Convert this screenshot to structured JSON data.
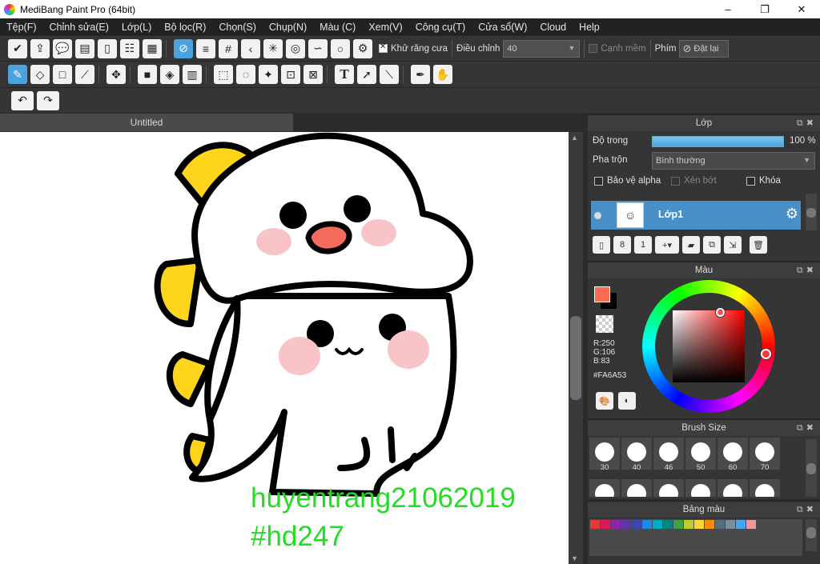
{
  "window": {
    "title": "MediBang Paint Pro (64bit)",
    "minimize": "–",
    "maximize": "❐",
    "close": "✕"
  },
  "menu": [
    "Tệp(F)",
    "Chỉnh sửa(E)",
    "Lớp(L)",
    "Bộ lọc(R)",
    "Chọn(S)",
    "Chụp(N)",
    "Màu (C)",
    "Xem(V)",
    "Công cụ(T)",
    "Cửa sổ(W)",
    "Cloud",
    "Help"
  ],
  "toolbar1": {
    "antialias_label": "Khử răng cưa",
    "adjust_label": "Điều chỉnh",
    "adjust_value": "40",
    "soft_edge_label": "Cạnh mềm",
    "key_label": "Phím",
    "reset_label": "Đặt lại"
  },
  "tab": {
    "title": "Untitled"
  },
  "canvas": {
    "watermark_line1": "huyentrang21062019",
    "watermark_line2": "#hd247",
    "watermark_color": "#22dd22"
  },
  "layer_panel": {
    "title": "Lớp",
    "opacity_label": "Độ trong",
    "opacity_value": "100 %",
    "opacity_fraction": 1.0,
    "blend_label": "Pha trộn",
    "blend_value": "Bình thường",
    "protect_alpha": "Bảo vệ alpha",
    "clipping": "Xén bớt",
    "lock": "Khóa",
    "layer_name": "Lớp1"
  },
  "color_panel": {
    "title": "Màu",
    "r": "R:250",
    "g": "G:106",
    "b": "B:83",
    "hex": "#FA6A53",
    "fg_color": "#FA6A53",
    "bg_color": "#000000"
  },
  "brush_panel": {
    "title": "Brush Size",
    "sizes": [
      "30",
      "40",
      "46",
      "50",
      "60",
      "70"
    ]
  },
  "palette_panel": {
    "title": "Bảng màu",
    "colors": [
      "#e53935",
      "#d81b60",
      "#8e24aa",
      "#5e35b1",
      "#3949ab",
      "#1e88e5",
      "#00acc1",
      "#00897b",
      "#43a047",
      "#c0ca33",
      "#fdd835",
      "#fb8c00",
      "#546e7a",
      "#78909c",
      "#42a5f5",
      "#ef9a9a"
    ]
  }
}
